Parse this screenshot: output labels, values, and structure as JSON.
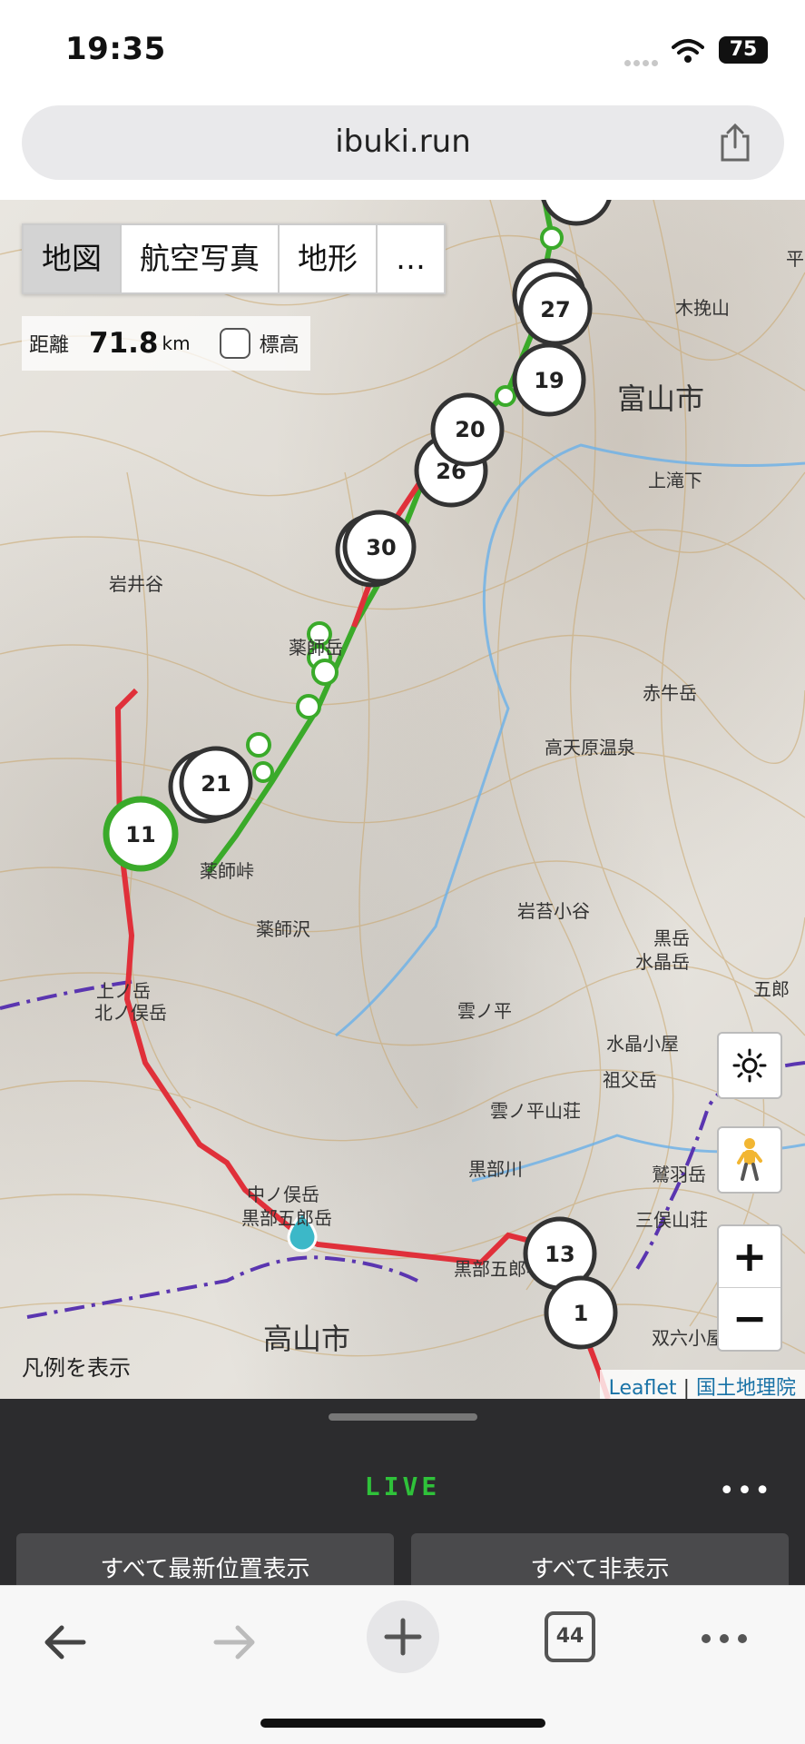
{
  "status_bar": {
    "time": "19:35",
    "battery": "75"
  },
  "browser": {
    "url": "ibuki.run",
    "tab_count": "44"
  },
  "map": {
    "layers": [
      {
        "label": "地図",
        "active": true
      },
      {
        "label": "航空写真",
        "active": false
      },
      {
        "label": "地形",
        "active": false
      },
      {
        "label": "…",
        "active": false
      }
    ],
    "distance_label": "距離",
    "distance_value": "71.8",
    "distance_unit": "km",
    "elevation_label": "標高",
    "legend_link": "凡例を表示",
    "attribution": {
      "leaflet": "Leaflet",
      "separator": "|",
      "gsi": "国土地理院"
    },
    "zoom_in": "+",
    "zoom_out": "−",
    "place_labels": {
      "toyama": "富山市",
      "takayama": "高山市",
      "kusunokiyama": "木挽山",
      "kamitaki": "上滝下",
      "yakushidake": "薬師岳",
      "akaushidake": "赤牛岳",
      "takamagahara": "高天原温泉",
      "kurodake": "黒岳",
      "suishodake": "水晶岳",
      "suisho_hut": "水晶小屋",
      "sobudake": "祖父岳",
      "kumonodaira": "雲ノ平",
      "kumonodaira_sanso": "雲ノ平山荘",
      "mitsumata": "三俣山荘",
      "kurobegawa": "黒部川",
      "kitanomata": "北ノ俣岳",
      "kaminodake": "上ノ岳",
      "kurobegoro": "黒部五郎岳",
      "kurobegoro_hut": "黒部五郎小屋",
      "nakanomata": "中ノ俣岳",
      "iwaidani": "岩井谷",
      "yakushizawa": "薬師沢",
      "iwaodani": "岩苔小谷",
      "sugoroku": "双六小屋",
      "washiba": "鷲羽岳",
      "goro": "五郎",
      "yakushitoge": "薬師峠",
      "zero": "平"
    },
    "markers": [
      "27",
      "19",
      "20",
      "26",
      "30",
      "21",
      "11",
      "13",
      "1"
    ]
  },
  "panel": {
    "live_label": "LIVE",
    "more": "•••",
    "show_all_latest": "すべて最新位置表示",
    "hide_all": "すべて非表示"
  },
  "colors": {
    "route_red": "#e0303a",
    "route_green": "#3aaa2a",
    "live_green": "#2fc23a"
  }
}
